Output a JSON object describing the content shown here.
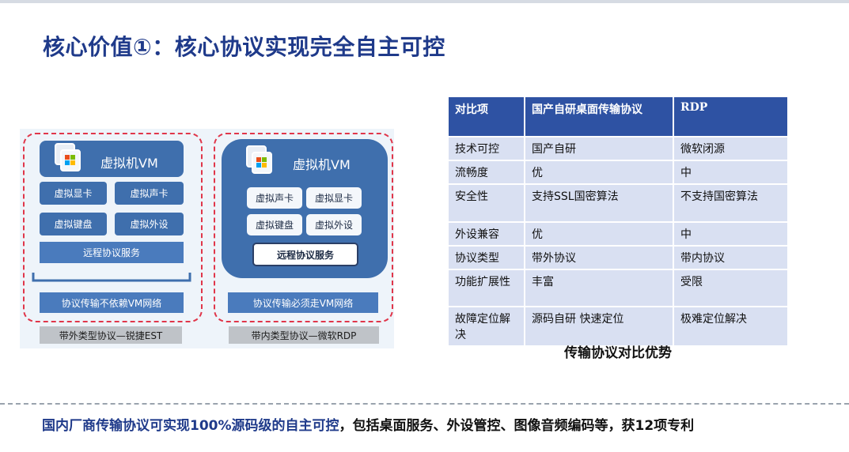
{
  "title": "核心价值①：核心协议实现完全自主可控",
  "diagram": {
    "left": {
      "vm_label": "虚拟机VM",
      "chips": [
        "虚拟显卡",
        "虚拟声卡",
        "虚拟键盘",
        "虚拟外设"
      ],
      "service": "远程协议服务",
      "transport": "协议传输不依赖VM网络",
      "caption": "带外类型协议—锐捷EST"
    },
    "right": {
      "vm_label": "虚拟机VM",
      "chips": [
        "虚拟声卡",
        "虚拟显卡",
        "虚拟键盘",
        "虚拟外设"
      ],
      "service": "远程协议服务",
      "transport": "协议传输必须走VM网络",
      "caption": "带内类型协议—微软RDP"
    }
  },
  "table": {
    "headers": [
      "对比项",
      "国产自研桌面传输协议",
      "RDP"
    ],
    "rows": [
      [
        "技术可控",
        "国产自研",
        "微软闭源"
      ],
      [
        "流畅度",
        "优",
        "中"
      ],
      [
        "安全性",
        "支持SSL国密算法",
        "不支持国密算法"
      ],
      [
        "外设兼容",
        "优",
        "中"
      ],
      [
        "协议类型",
        "带外协议",
        "带内协议"
      ],
      [
        "功能扩展性",
        "丰富",
        "受限"
      ],
      [
        "故障定位解决",
        "源码自研 快速定位",
        "极难定位解决"
      ]
    ],
    "caption": "传输协议对比优势"
  },
  "footer": {
    "highlight": "国内厂商传输协议可实现100%源码级的自主可控",
    "rest": "，包括桌面服务、外设管控、图像音频编码等，获12项专利"
  },
  "colors": {
    "accent": "#1f3a8a",
    "header": "#2e52a3",
    "cell": "#d9e0f2",
    "vm_blue": "#3f6fad",
    "dash_red": "#e0364a"
  },
  "icons": [
    "windows-vm-icon"
  ]
}
